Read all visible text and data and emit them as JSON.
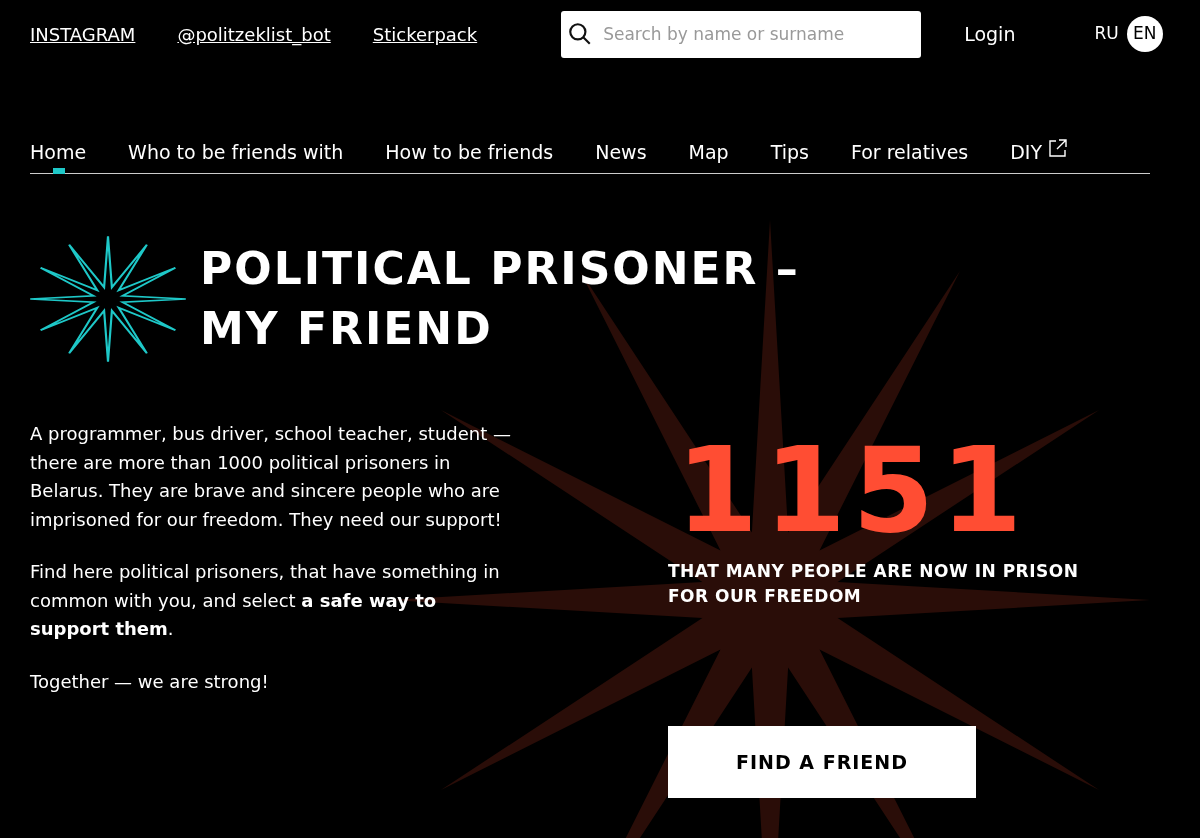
{
  "top_links": [
    "INSTAGRAM",
    "@politzeklist_bot",
    "Stickerpack"
  ],
  "search": {
    "placeholder": "Search by name or surname"
  },
  "login": "Login",
  "languages": [
    {
      "label": "RU",
      "selected": false
    },
    {
      "label": "EN",
      "selected": true
    }
  ],
  "nav": [
    {
      "label": "Home",
      "selected": true,
      "external": false
    },
    {
      "label": "Who to be friends with",
      "selected": false,
      "external": false
    },
    {
      "label": "How to be friends",
      "selected": false,
      "external": false
    },
    {
      "label": "News",
      "selected": false,
      "external": false
    },
    {
      "label": "Map",
      "selected": false,
      "external": false
    },
    {
      "label": "Tips",
      "selected": false,
      "external": false
    },
    {
      "label": "For relatives",
      "selected": false,
      "external": false
    },
    {
      "label": "DIY",
      "selected": false,
      "external": true
    }
  ],
  "title": [
    "POLITICAL PRISONER –",
    "MY FRIEND"
  ],
  "paragraphs": [
    "A programmer, bus driver, school teacher, student — there are more than 1000 political prisoners in Belarus. They are brave and sincere people who are imprisoned for our freedom. They need our support!",
    "Find here political prisoners, that have something in common with you, and select **a safe way to support them**.",
    "Together — we are strong!"
  ],
  "counter": {
    "value": "1151",
    "caption": "THAT MANY PEOPLE ARE NOW IN PRISON FOR OUR FREEDOM"
  },
  "cta": "FIND A FRIEND"
}
